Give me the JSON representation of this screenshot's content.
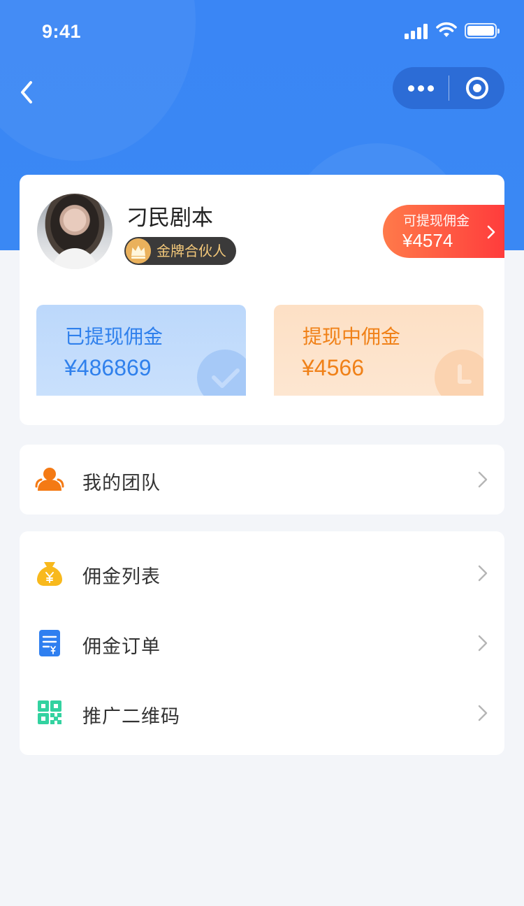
{
  "status_bar": {
    "time": "9:41"
  },
  "profile": {
    "name": "刁民剧本",
    "badge": "金牌合伙人",
    "withdrawable": {
      "label": "可提现佣金",
      "amount": "¥4574"
    }
  },
  "stats": {
    "withdrawn": {
      "label": "已提现佣金",
      "amount": "¥486869"
    },
    "pending": {
      "label": "提现中佣金",
      "amount": "¥4566"
    }
  },
  "menu": {
    "team": {
      "label": "我的团队",
      "icon": "team-icon"
    },
    "items": [
      {
        "label": "佣金列表",
        "icon": "money-bag-icon"
      },
      {
        "label": "佣金订单",
        "icon": "order-icon"
      },
      {
        "label": "推广二维码",
        "icon": "qr-code-icon"
      }
    ]
  },
  "colors": {
    "primary": "#3a86f5",
    "withdrawable_gradient": [
      "#ff7a4a",
      "#ff3c3c"
    ],
    "withdrawn_text": "#2f80ec",
    "pending_text": "#f08118",
    "gold": "#f3c87a"
  }
}
